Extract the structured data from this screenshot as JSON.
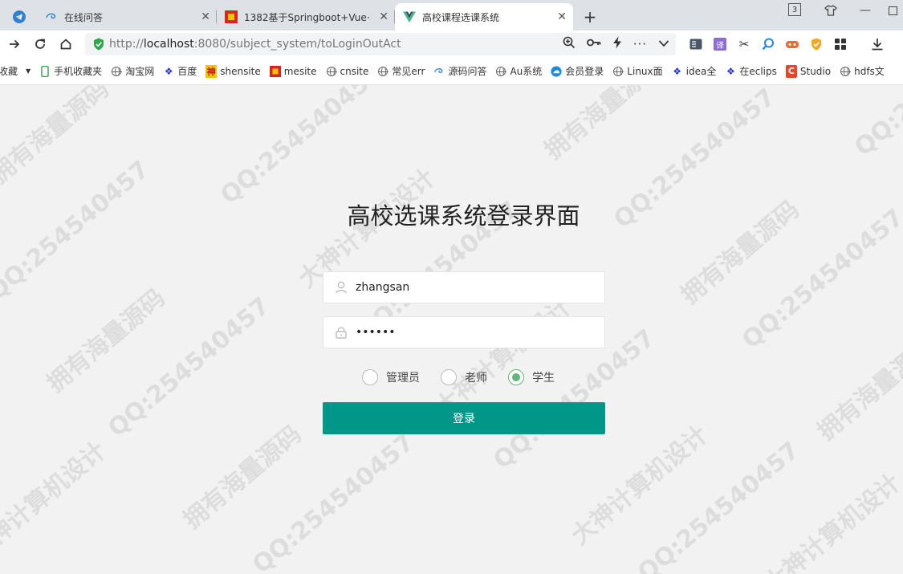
{
  "browser": {
    "tabs": [
      {
        "title": "在线问答",
        "active": false
      },
      {
        "title": "1382基于Springboot+Vue+",
        "active": false
      },
      {
        "title": "高校课程选课系统",
        "active": true
      }
    ],
    "tab_count_badge": "3",
    "url_scheme": "http://",
    "url_host": "localhost",
    "url_rest": ":8080/subject_system/toLoginOutAct",
    "bookmarks": [
      {
        "label": "收藏",
        "icon": "folder-icon"
      },
      {
        "label": "手机收藏夹",
        "icon": "phone-icon"
      },
      {
        "label": "淘宝网",
        "icon": "globe-icon"
      },
      {
        "label": "百度",
        "icon": "baidu-paw-icon"
      },
      {
        "label": "shensite",
        "icon": "shen-icon"
      },
      {
        "label": "mesite",
        "icon": "mesite-icon"
      },
      {
        "label": "cnsite",
        "icon": "globe-icon"
      },
      {
        "label": "常见err",
        "icon": "globe-icon"
      },
      {
        "label": "源码问答",
        "icon": "swirl-icon"
      },
      {
        "label": "Au系统",
        "icon": "globe-icon"
      },
      {
        "label": "会员登录",
        "icon": "cloud-icon"
      },
      {
        "label": "Linux面",
        "icon": "globe-icon"
      },
      {
        "label": "idea全",
        "icon": "baidu-paw-icon"
      },
      {
        "label": "在eclips",
        "icon": "baidu-paw-icon"
      },
      {
        "label": "Studio",
        "icon": "csdn-icon"
      },
      {
        "label": "hdfs文",
        "icon": "globe-icon"
      }
    ]
  },
  "login": {
    "title": "高校选课系统登录界面",
    "username_value": "zhangsan",
    "password_value": "123456",
    "roles": [
      {
        "label": "管理员",
        "checked": false
      },
      {
        "label": "老师",
        "checked": false
      },
      {
        "label": "学生",
        "checked": true
      }
    ],
    "submit_label": "登录"
  },
  "watermarks": {
    "qq": "QQ:254540457",
    "owner": "拥有海量源码",
    "design": "大神计算机设计"
  },
  "colors": {
    "accent": "#009688",
    "radio_checked": "#5fb878",
    "page_bg": "#f2f2f2"
  }
}
